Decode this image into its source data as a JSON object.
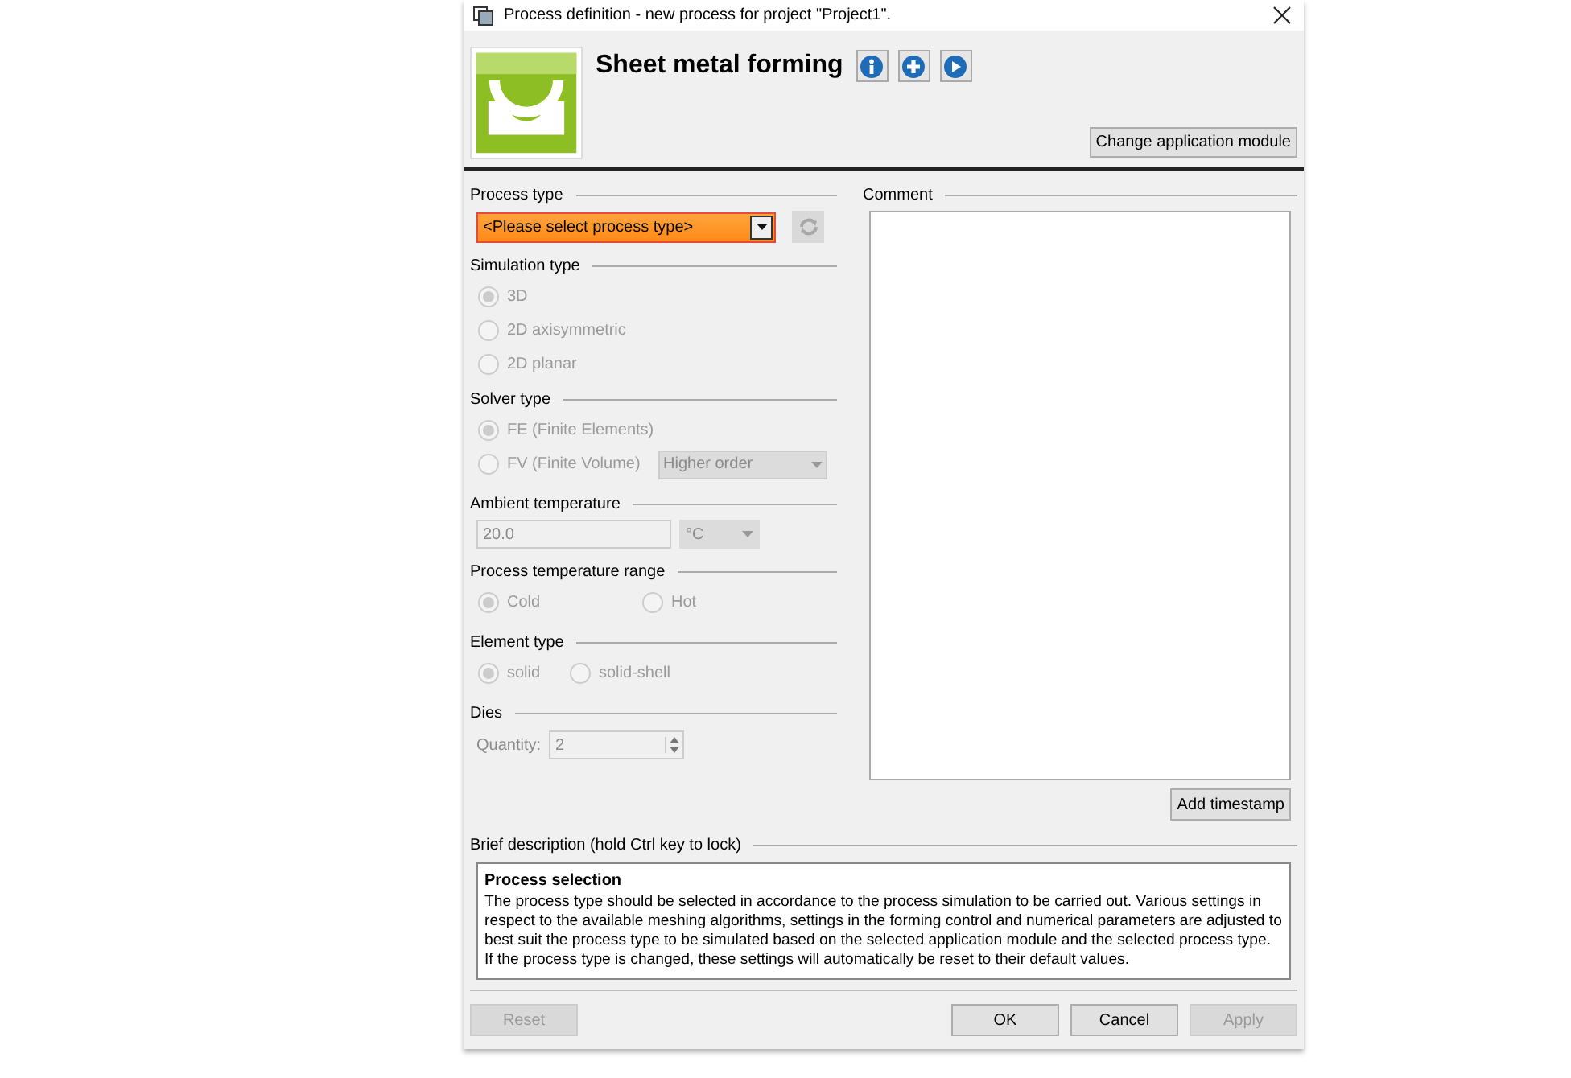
{
  "window": {
    "title": "Process definition - new process for project \"Project1\"."
  },
  "header": {
    "title": "Sheet metal forming",
    "change_module_button": "Change application module"
  },
  "process_type": {
    "label": "Process type",
    "value": "<Please select process type>",
    "highlighted": true
  },
  "simulation_type": {
    "label": "Simulation type",
    "disabled": true,
    "options": [
      {
        "label": "3D",
        "selected": true
      },
      {
        "label": "2D axisymmetric",
        "selected": false
      },
      {
        "label": "2D planar",
        "selected": false
      }
    ]
  },
  "solver_type": {
    "label": "Solver type",
    "disabled": true,
    "options": [
      {
        "label": "FE (Finite Elements)",
        "selected": true
      },
      {
        "label": "FV (Finite Volume)",
        "selected": false
      }
    ],
    "order_value": "Higher order"
  },
  "ambient_temperature": {
    "label": "Ambient temperature",
    "value": "20.0",
    "unit": "°C",
    "disabled": true
  },
  "process_temperature_range": {
    "label": "Process temperature range",
    "disabled": true,
    "options": [
      {
        "label": "Cold",
        "selected": true
      },
      {
        "label": "Hot",
        "selected": false
      }
    ]
  },
  "element_type": {
    "label": "Element type",
    "disabled": true,
    "options": [
      {
        "label": "solid",
        "selected": true
      },
      {
        "label": "solid-shell",
        "selected": false
      }
    ]
  },
  "dies": {
    "label": "Dies",
    "quantity_label": "Quantity:",
    "quantity": "2",
    "disabled": true
  },
  "comment": {
    "label": "Comment",
    "add_timestamp_button": "Add timestamp"
  },
  "brief_description": {
    "label": "Brief description (hold Ctrl key to lock)",
    "heading": "Process selection",
    "text": "The process type should be selected in accordance to the process simulation to be carried out. Various settings in respect to the available meshing algorithms, settings in the forming control and numerical parameters are adjusted to best suit the process type to be simulated based on the selected application module and the selected process type. If the process type is changed, these settings will automatically be reset to their default values."
  },
  "buttons": [
    {
      "label": "Reset",
      "disabled": true
    },
    {
      "label": "OK",
      "disabled": false
    },
    {
      "label": "Cancel",
      "disabled": false
    },
    {
      "label": "Apply",
      "disabled": true
    }
  ]
}
